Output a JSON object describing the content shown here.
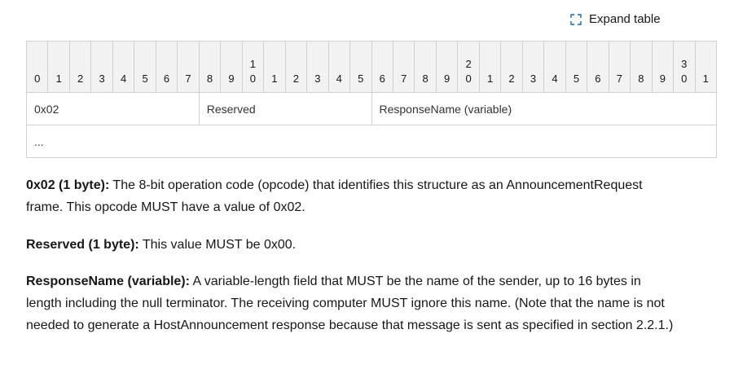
{
  "expand": {
    "label": "Expand table",
    "icon": "expand-icon"
  },
  "table": {
    "header_tens": [
      "",
      "",
      "",
      "",
      "",
      "",
      "",
      "",
      "",
      "",
      "1",
      "",
      "",
      "",
      "",
      "",
      "",
      "",
      "",
      "",
      "2",
      "",
      "",
      "",
      "",
      "",
      "",
      "",
      "",
      "",
      "3",
      ""
    ],
    "header_ones": [
      "0",
      "1",
      "2",
      "3",
      "4",
      "5",
      "6",
      "7",
      "8",
      "9",
      "0",
      "1",
      "2",
      "3",
      "4",
      "5",
      "6",
      "7",
      "8",
      "9",
      "0",
      "1",
      "2",
      "3",
      "4",
      "5",
      "6",
      "7",
      "8",
      "9",
      "0",
      "1"
    ],
    "fields": [
      {
        "label": "0x02"
      },
      {
        "label": "Reserved"
      },
      {
        "label": "ResponseName (variable)"
      }
    ],
    "continuation": "..."
  },
  "descriptions": [
    {
      "term": "0x02 (1 byte):",
      "text": " The 8-bit operation code (opcode) that identifies this structure as an AnnouncementRequest frame. This opcode MUST have a value of 0x02."
    },
    {
      "term": "Reserved (1 byte):",
      "text": " This value MUST be 0x00."
    },
    {
      "term": "ResponseName (variable):",
      "text": " A variable-length field that MUST be the name of the sender, up to 16 bytes in length including the null terminator. The receiving computer MUST ignore this name. (Note that the name is not needed to generate a HostAnnouncement response because that message is sent as specified in section 2.2.1.)"
    }
  ]
}
